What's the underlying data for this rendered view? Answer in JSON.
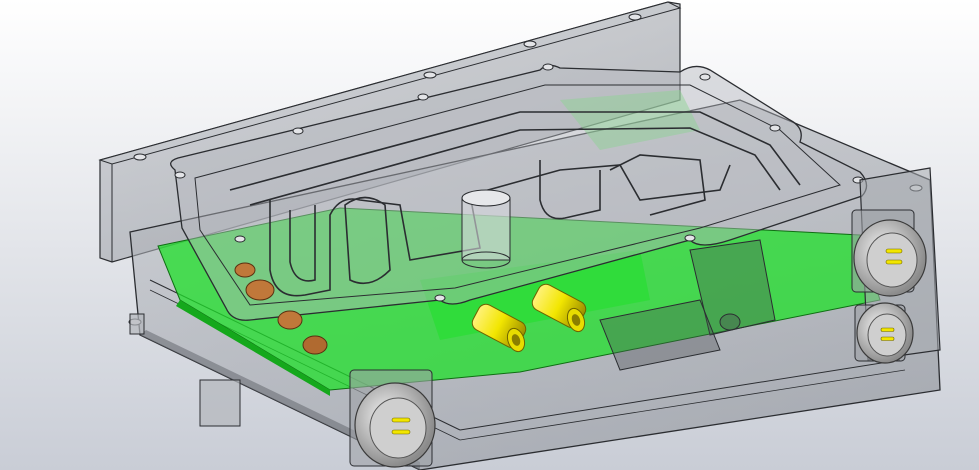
{
  "viewport": {
    "background_top": "#ffffff",
    "background_bottom": "#c9cdd6"
  },
  "colors": {
    "housing_fill": "#9fa3aa",
    "housing_edge": "#2b2d31",
    "pcb_green": "#1fe02a",
    "pcb_dark": "#15a81c",
    "fitting_yellow": "#f2e600",
    "fitting_dark": "#a89a00",
    "copper": "#c0783a",
    "connector_silver": "#d8d8d8",
    "connector_dark": "#6a6a6a"
  },
  "model": {
    "description_visible": false,
    "parts": [
      "housing",
      "lid",
      "cooling-channel",
      "pcb",
      "coolant-fittings",
      "circular-connectors",
      "inductors",
      "mounting-screws"
    ]
  }
}
